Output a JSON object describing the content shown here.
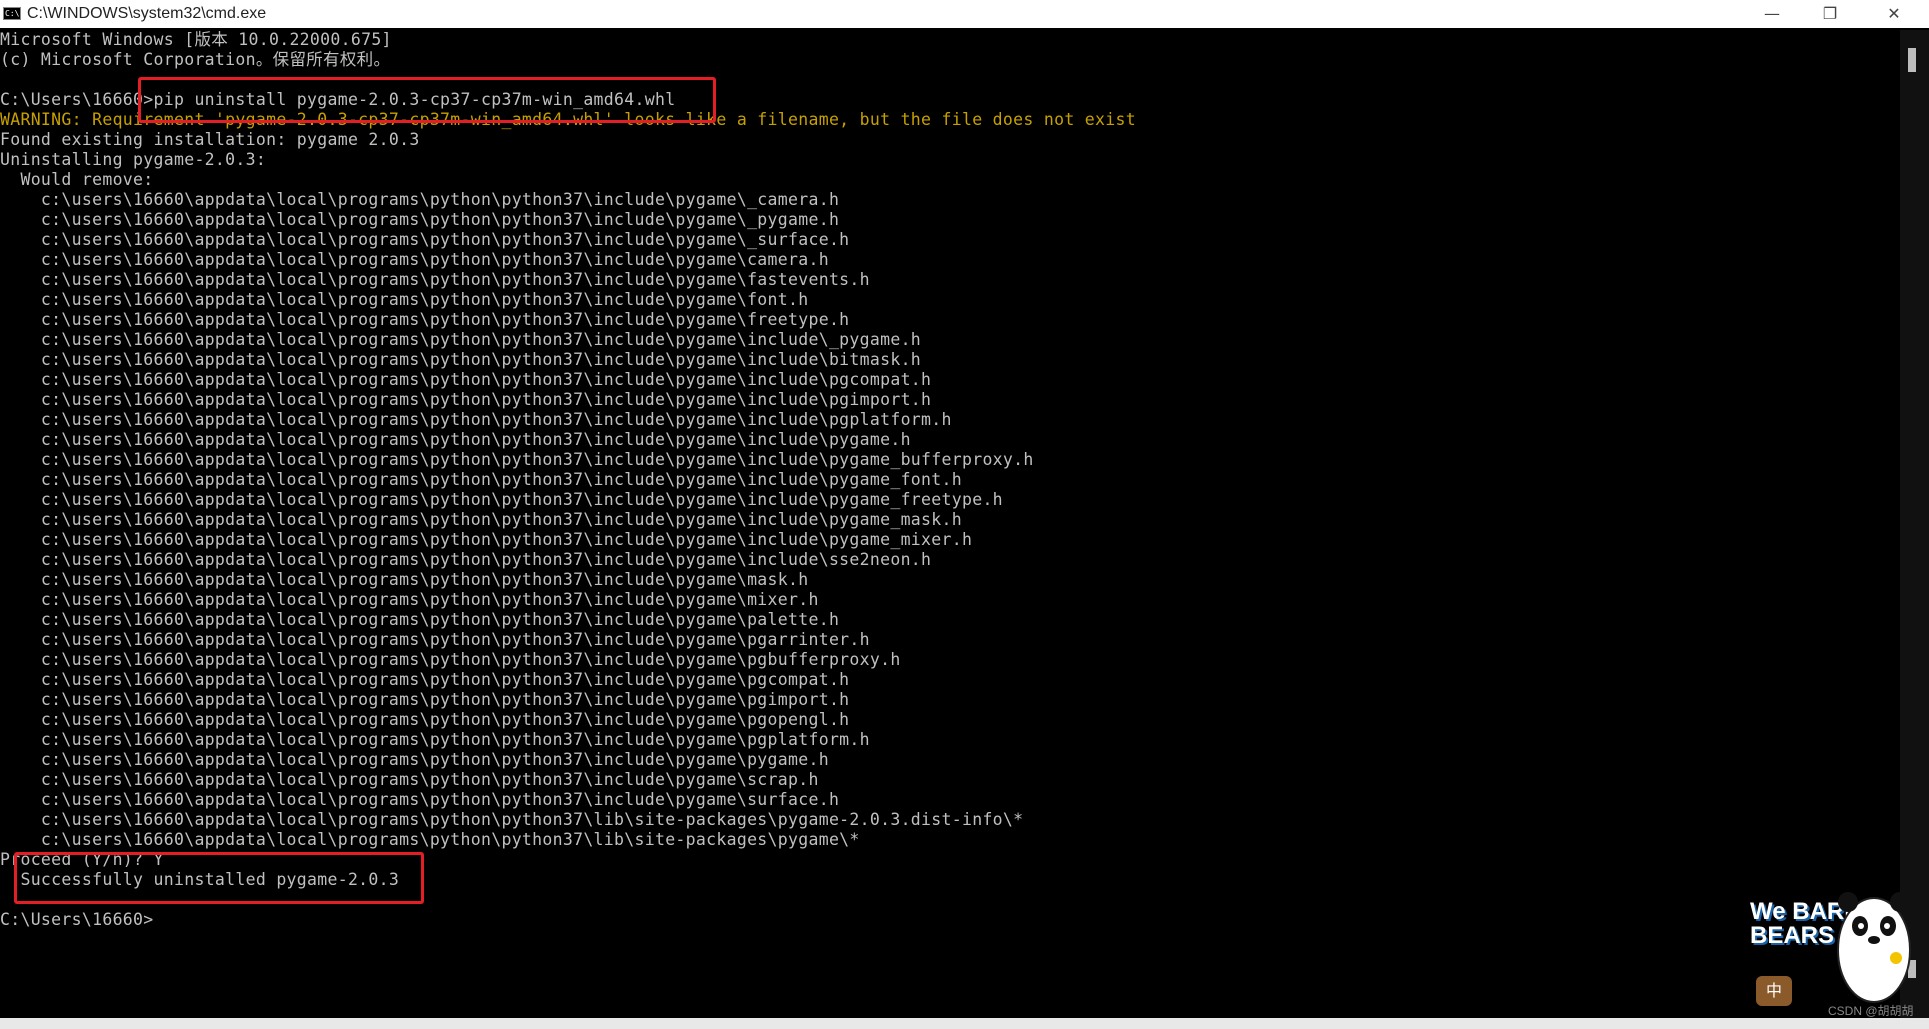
{
  "window": {
    "title": "C:\\WINDOWS\\system32\\cmd.exe",
    "icon": "cmd-icon",
    "controls": {
      "minimize": "—",
      "maximize": "❐",
      "close": "✕"
    }
  },
  "console": {
    "lines": [
      "Microsoft Windows [版本 10.0.22000.675]",
      "(c) Microsoft Corporation。保留所有权利。",
      "",
      "C:\\Users\\16660>pip uninstall pygame-2.0.3-cp37-cp37m-win_amd64.whl",
      "WARNING: Requirement 'pygame-2.0.3-cp37-cp37m-win_amd64.whl' looks like a filename, but the file does not exist",
      "Found existing installation: pygame 2.0.3",
      "Uninstalling pygame-2.0.3:",
      "  Would remove:",
      "    c:\\users\\16660\\appdata\\local\\programs\\python\\python37\\include\\pygame\\_camera.h",
      "    c:\\users\\16660\\appdata\\local\\programs\\python\\python37\\include\\pygame\\_pygame.h",
      "    c:\\users\\16660\\appdata\\local\\programs\\python\\python37\\include\\pygame\\_surface.h",
      "    c:\\users\\16660\\appdata\\local\\programs\\python\\python37\\include\\pygame\\camera.h",
      "    c:\\users\\16660\\appdata\\local\\programs\\python\\python37\\include\\pygame\\fastevents.h",
      "    c:\\users\\16660\\appdata\\local\\programs\\python\\python37\\include\\pygame\\font.h",
      "    c:\\users\\16660\\appdata\\local\\programs\\python\\python37\\include\\pygame\\freetype.h",
      "    c:\\users\\16660\\appdata\\local\\programs\\python\\python37\\include\\pygame\\include\\_pygame.h",
      "    c:\\users\\16660\\appdata\\local\\programs\\python\\python37\\include\\pygame\\include\\bitmask.h",
      "    c:\\users\\16660\\appdata\\local\\programs\\python\\python37\\include\\pygame\\include\\pgcompat.h",
      "    c:\\users\\16660\\appdata\\local\\programs\\python\\python37\\include\\pygame\\include\\pgimport.h",
      "    c:\\users\\16660\\appdata\\local\\programs\\python\\python37\\include\\pygame\\include\\pgplatform.h",
      "    c:\\users\\16660\\appdata\\local\\programs\\python\\python37\\include\\pygame\\include\\pygame.h",
      "    c:\\users\\16660\\appdata\\local\\programs\\python\\python37\\include\\pygame\\include\\pygame_bufferproxy.h",
      "    c:\\users\\16660\\appdata\\local\\programs\\python\\python37\\include\\pygame\\include\\pygame_font.h",
      "    c:\\users\\16660\\appdata\\local\\programs\\python\\python37\\include\\pygame\\include\\pygame_freetype.h",
      "    c:\\users\\16660\\appdata\\local\\programs\\python\\python37\\include\\pygame\\include\\pygame_mask.h",
      "    c:\\users\\16660\\appdata\\local\\programs\\python\\python37\\include\\pygame\\include\\pygame_mixer.h",
      "    c:\\users\\16660\\appdata\\local\\programs\\python\\python37\\include\\pygame\\include\\sse2neon.h",
      "    c:\\users\\16660\\appdata\\local\\programs\\python\\python37\\include\\pygame\\mask.h",
      "    c:\\users\\16660\\appdata\\local\\programs\\python\\python37\\include\\pygame\\mixer.h",
      "    c:\\users\\16660\\appdata\\local\\programs\\python\\python37\\include\\pygame\\palette.h",
      "    c:\\users\\16660\\appdata\\local\\programs\\python\\python37\\include\\pygame\\pgarrinter.h",
      "    c:\\users\\16660\\appdata\\local\\programs\\python\\python37\\include\\pygame\\pgbufferproxy.h",
      "    c:\\users\\16660\\appdata\\local\\programs\\python\\python37\\include\\pygame\\pgcompat.h",
      "    c:\\users\\16660\\appdata\\local\\programs\\python\\python37\\include\\pygame\\pgimport.h",
      "    c:\\users\\16660\\appdata\\local\\programs\\python\\python37\\include\\pygame\\pgopengl.h",
      "    c:\\users\\16660\\appdata\\local\\programs\\python\\python37\\include\\pygame\\pgplatform.h",
      "    c:\\users\\16660\\appdata\\local\\programs\\python\\python37\\include\\pygame\\pygame.h",
      "    c:\\users\\16660\\appdata\\local\\programs\\python\\python37\\include\\pygame\\scrap.h",
      "    c:\\users\\16660\\appdata\\local\\programs\\python\\python37\\include\\pygame\\surface.h",
      "    c:\\users\\16660\\appdata\\local\\programs\\python\\python37\\lib\\site-packages\\pygame-2.0.3.dist-info\\*",
      "    c:\\users\\16660\\appdata\\local\\programs\\python\\python37\\lib\\site-packages\\pygame\\*",
      "Proceed (Y/n)? Y",
      "  Successfully uninstalled pygame-2.0.3",
      "",
      "C:\\Users\\16660>"
    ],
    "warning_line_index": 4
  },
  "colors": {
    "background": "#000000",
    "text": "#c0c0c0",
    "warning": "#c6a000",
    "highlight": "#e31e24"
  },
  "watermark": {
    "brand": "We BARE BEARS",
    "cn_badge": "中",
    "csdn": "CSDN @胡胡胡"
  }
}
